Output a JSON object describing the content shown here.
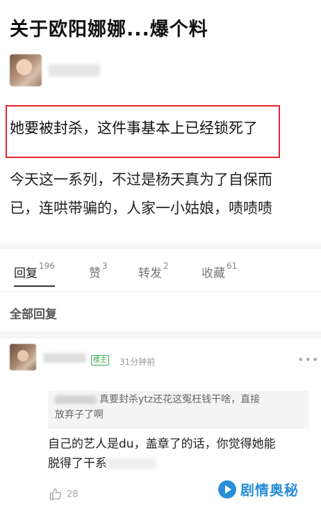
{
  "post": {
    "title": "关于欧阳娜娜...爆个料",
    "highlight": "她要被封杀，这件事基本上已经锁死了",
    "body_line1": "今天这一系列，不过是杨天真为了自保而",
    "body_line2": "已，连哄带骗的，人家一小姑娘，啧啧啧"
  },
  "tabs": [
    {
      "label": "回复",
      "count": "196"
    },
    {
      "label": "赞",
      "count": "3"
    },
    {
      "label": "转发",
      "count": "2"
    },
    {
      "label": "收藏",
      "count": "61"
    }
  ],
  "replies_header": "全部回复",
  "comment": {
    "badge": "楼主",
    "time": "31分钟前",
    "more": "•••",
    "quote_text": "真要封杀ytz还花这冤枉钱干啥，直接",
    "quote_text2": "放弃子了啊",
    "text": "自己的艺人是du，盖章了的话，你觉得她能",
    "text2": "脱得了干系",
    "likes": "28"
  },
  "watermark": "剧情奥秘"
}
